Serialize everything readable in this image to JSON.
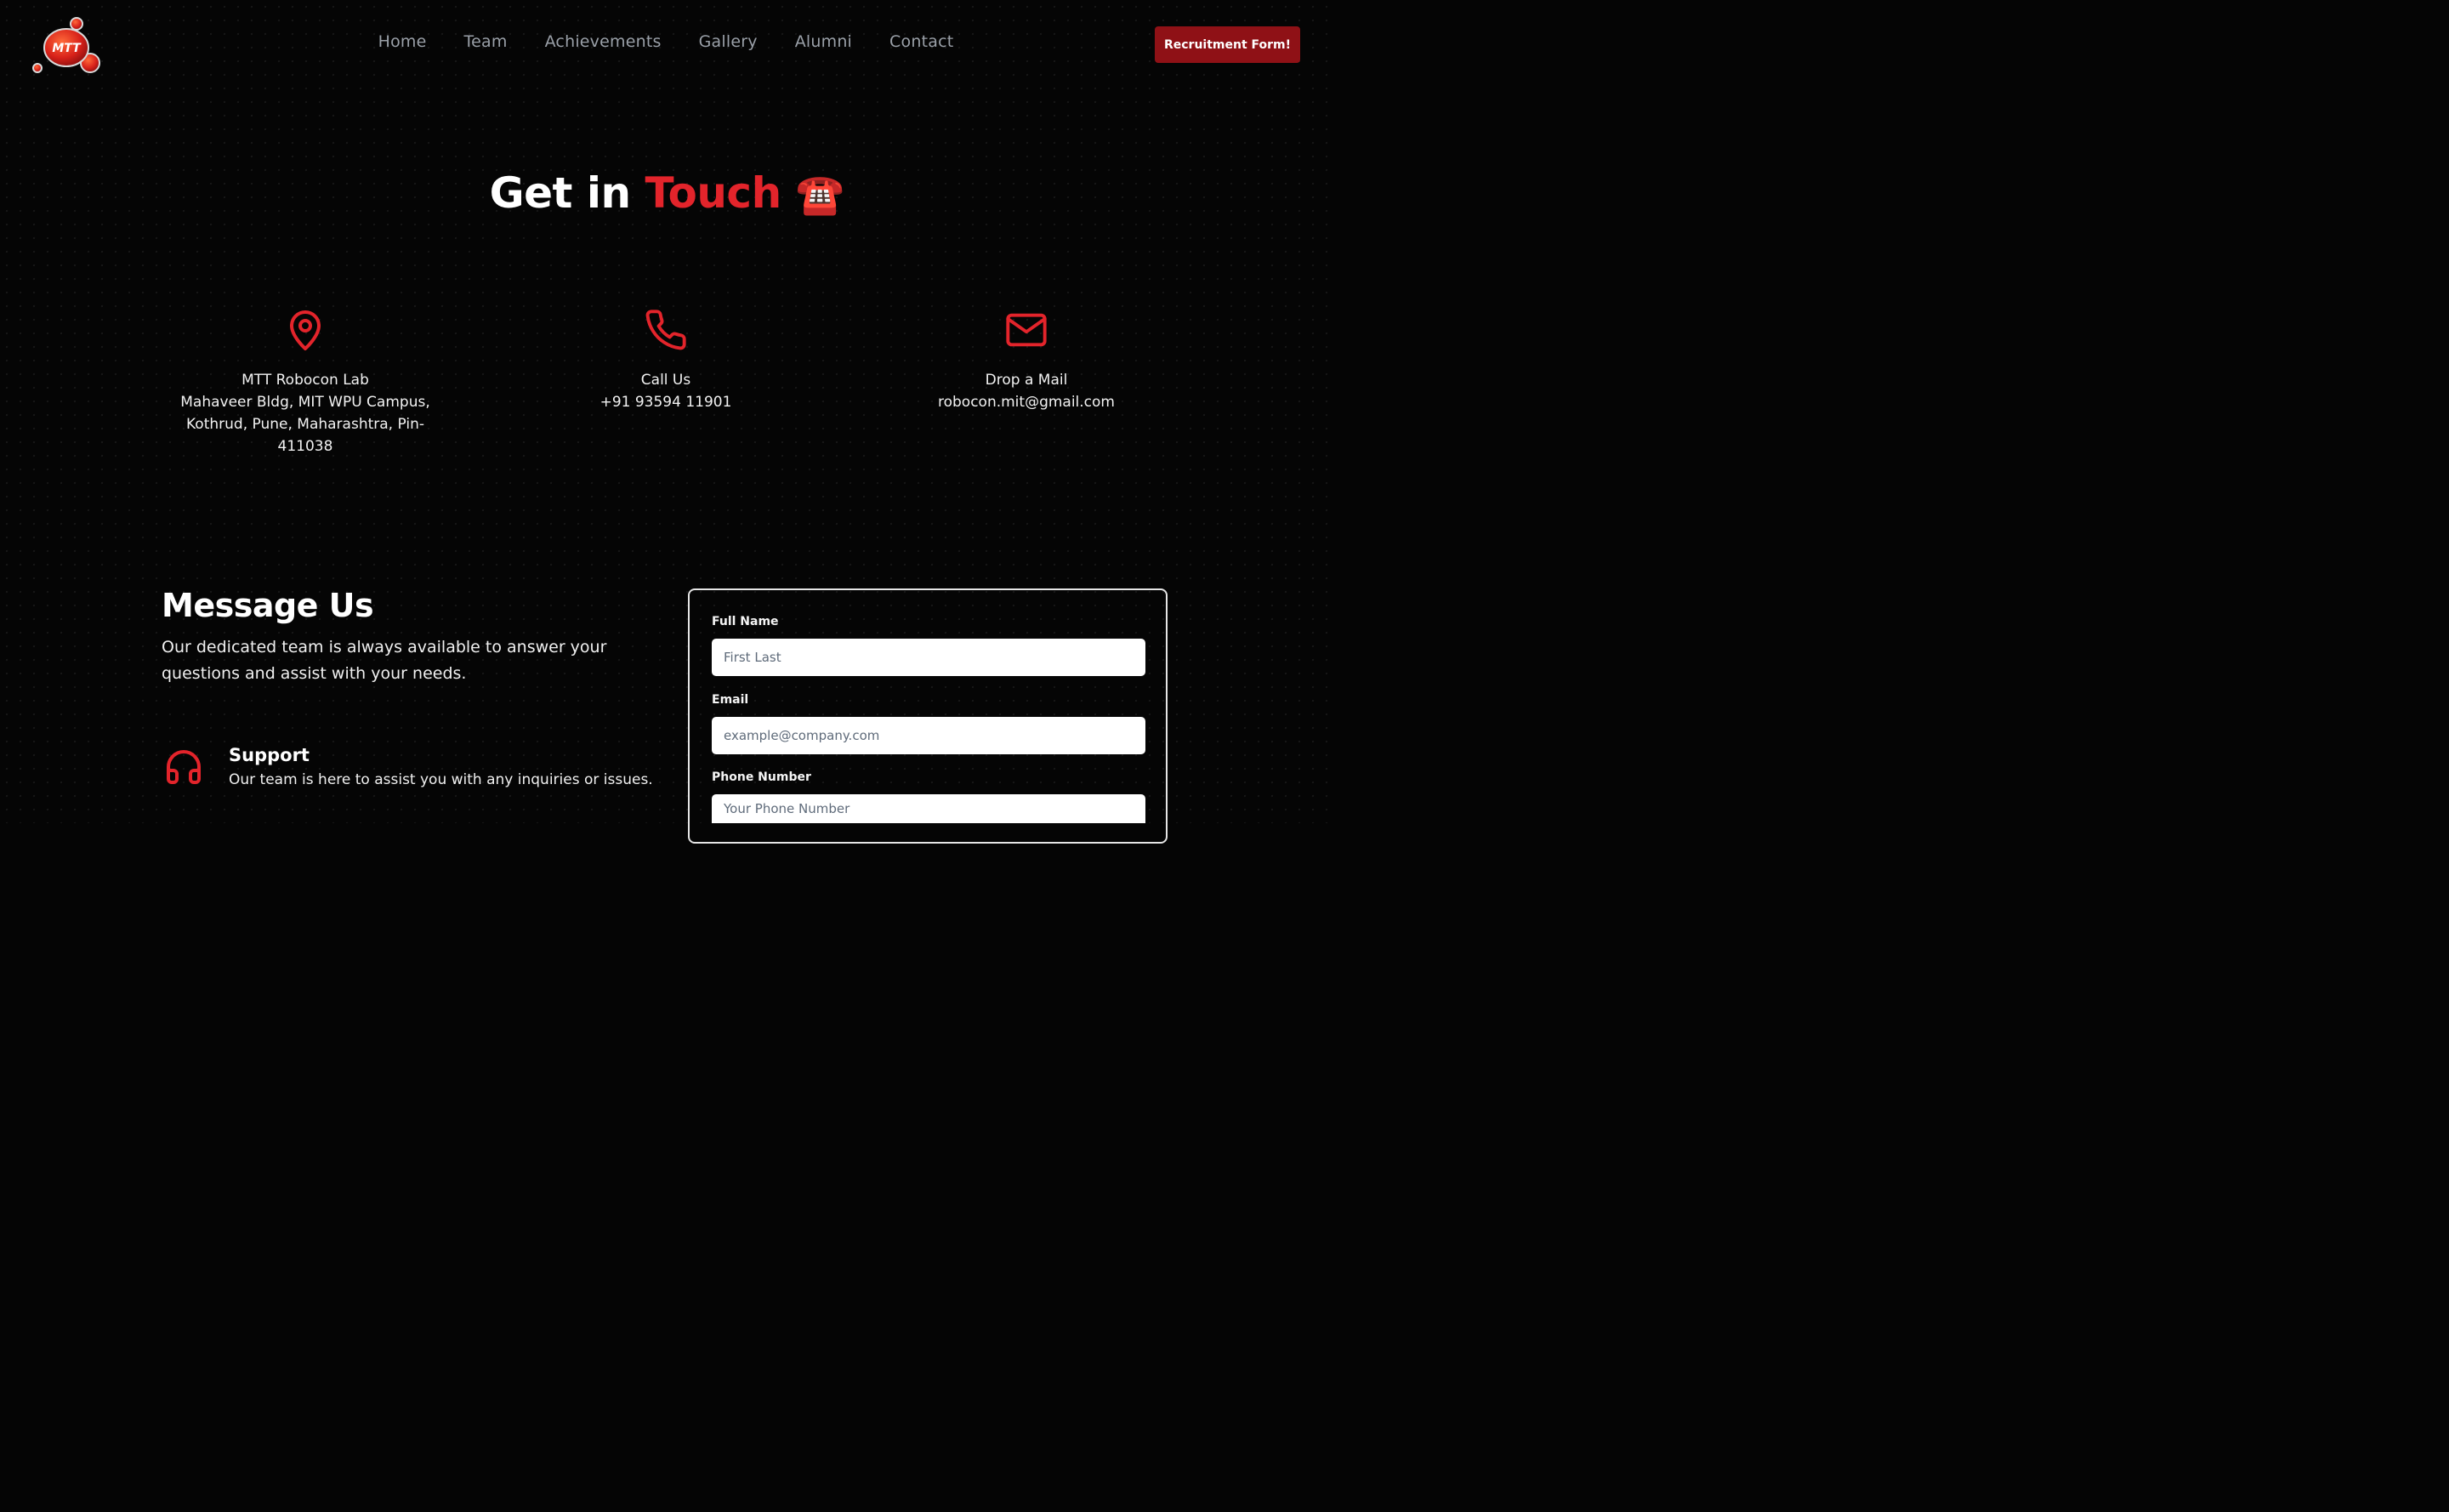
{
  "header": {
    "logo_text": "MTT",
    "nav": [
      "Home",
      "Team",
      "Achievements",
      "Gallery",
      "Alumni",
      "Contact"
    ],
    "cta_label": "Recruitment Form!"
  },
  "hero": {
    "title_prefix": "Get in ",
    "title_accent": "Touch",
    "title_emoji": "☎️"
  },
  "contact_info": {
    "address": {
      "icon": "location-pin-icon",
      "lines": [
        "MTT Robocon Lab",
        "Mahaveer Bldg, MIT WPU Campus,",
        "Kothrud, Pune, Maharashtra, Pin-",
        "411038"
      ]
    },
    "phone": {
      "icon": "phone-icon",
      "label": "Call Us",
      "value": "+91 93594 11901"
    },
    "mail": {
      "icon": "mail-icon",
      "label": "Drop a Mail",
      "value": "robocon.mit@gmail.com"
    }
  },
  "message": {
    "title": "Message Us",
    "subtitle": "Our dedicated team is always available to answer your questions and assist with your needs.",
    "support": {
      "icon": "headphones-icon",
      "title": "Support",
      "text": "Our team is here to assist you with any inquiries or issues."
    }
  },
  "form": {
    "full_name": {
      "label": "Full Name",
      "placeholder": "First Last"
    },
    "email": {
      "label": "Email",
      "placeholder": "example@company.com"
    },
    "phone": {
      "label": "Phone Number",
      "placeholder": "Your Phone Number"
    }
  },
  "colors": {
    "accent": "#e3242b",
    "cta": "#8f1116",
    "background": "#050505"
  }
}
